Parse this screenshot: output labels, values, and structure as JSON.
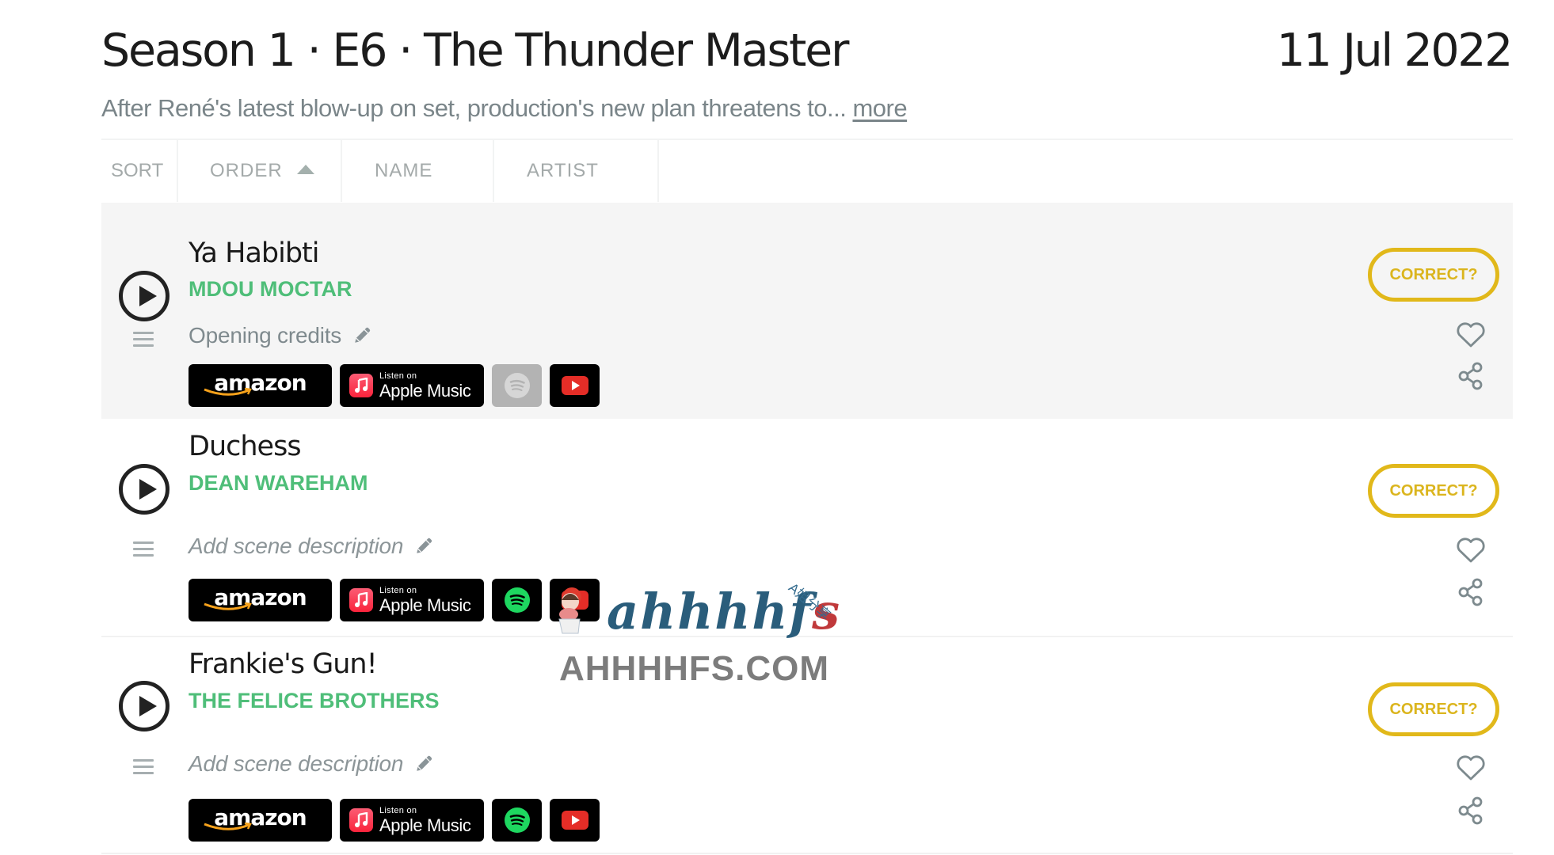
{
  "episode": {
    "title": "Season 1 · E6 · The Thunder Master",
    "air_date": "11 Jul 2022",
    "summary": "After René's latest blow-up on set, production's new plan threatens to...",
    "more_link": "more"
  },
  "sort_bar": {
    "label": "SORT",
    "columns": [
      {
        "label": "ORDER",
        "active": true,
        "direction": "ascending"
      },
      {
        "label": "NAME",
        "active": false
      },
      {
        "label": "ARTIST",
        "active": false
      }
    ]
  },
  "songs": [
    {
      "title": "Ya Habibti",
      "artist": "MDOU MOCTAR",
      "scene_description": "Opening credits",
      "scene_is_placeholder": false,
      "highlighted": true,
      "correct_label": "CORRECT?",
      "services": {
        "amazon": "amazon",
        "apple_small": "Listen on",
        "apple_big": "Apple Music",
        "spotify_available": false,
        "youtube_available": true
      }
    },
    {
      "title": "Duchess",
      "artist": "DEAN WAREHAM",
      "scene_description": "Add scene description",
      "scene_is_placeholder": true,
      "highlighted": false,
      "correct_label": "CORRECT?",
      "services": {
        "amazon": "amazon",
        "apple_small": "Listen on",
        "apple_big": "Apple Music",
        "spotify_available": true,
        "youtube_available": true
      }
    },
    {
      "title": "Frankie's Gun!",
      "artist": "THE FELICE BROTHERS",
      "scene_description": "Add scene description",
      "scene_is_placeholder": true,
      "highlighted": false,
      "correct_label": "CORRECT?",
      "services": {
        "amazon": "amazon",
        "apple_small": "Listen on",
        "apple_big": "Apple Music",
        "spotify_available": true,
        "youtube_available": true
      }
    }
  ],
  "colors": {
    "artist_green": "#4fbe79",
    "correct_yellow": "#e1b81a",
    "highlight_row_bg": "#f5f5f5",
    "muted_text": "#7a8589"
  },
  "watermark": {
    "script_text": "ahhhhf",
    "script_tail": "s",
    "chinese_tag": "A姐分享",
    "domain": "AHHHHFS.COM"
  }
}
